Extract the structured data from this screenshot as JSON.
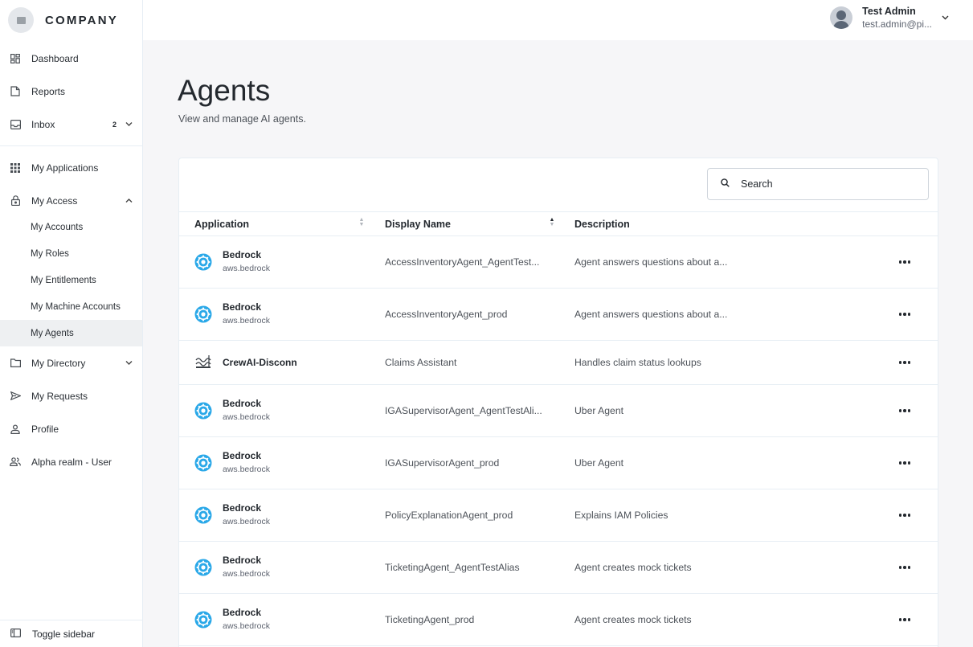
{
  "brand": {
    "name": "COMPANY"
  },
  "nav": {
    "dashboard": "Dashboard",
    "reports": "Reports",
    "inbox": "Inbox",
    "inbox_badge": "2",
    "my_applications": "My Applications",
    "my_access": "My Access",
    "my_access_sub": [
      "My Accounts",
      "My Roles",
      "My Entitlements",
      "My Machine Accounts",
      "My Agents"
    ],
    "my_directory": "My Directory",
    "my_requests": "My Requests",
    "profile": "Profile",
    "realm": "Alpha realm - User",
    "toggle": "Toggle sidebar"
  },
  "user": {
    "name": "Test Admin",
    "email": "test.admin@pi..."
  },
  "page": {
    "title": "Agents",
    "subtitle": "View and manage AI agents."
  },
  "search": {
    "placeholder": "Search"
  },
  "table": {
    "columns": {
      "application": "Application",
      "display_name": "Display Name",
      "description": "Description"
    },
    "rows": [
      {
        "app": "Bedrock",
        "app_sub": "aws.bedrock",
        "icon": "bedrock-icon",
        "display": "AccessInventoryAgent_AgentTest...",
        "desc": "Agent answers questions about a..."
      },
      {
        "app": "Bedrock",
        "app_sub": "aws.bedrock",
        "icon": "bedrock-icon",
        "display": "AccessInventoryAgent_prod",
        "desc": "Agent answers questions about a..."
      },
      {
        "app": "CrewAI-Disconn",
        "app_sub": "",
        "icon": "crewai-icon",
        "display": "Claims Assistant",
        "desc": "Handles claim status lookups"
      },
      {
        "app": "Bedrock",
        "app_sub": "aws.bedrock",
        "icon": "bedrock-icon",
        "display": "IGASupervisorAgent_AgentTestAli...",
        "desc": "Uber Agent"
      },
      {
        "app": "Bedrock",
        "app_sub": "aws.bedrock",
        "icon": "bedrock-icon",
        "display": "IGASupervisorAgent_prod",
        "desc": "Uber Agent"
      },
      {
        "app": "Bedrock",
        "app_sub": "aws.bedrock",
        "icon": "bedrock-icon",
        "display": "PolicyExplanationAgent_prod",
        "desc": "Explains IAM Policies"
      },
      {
        "app": "Bedrock",
        "app_sub": "aws.bedrock",
        "icon": "bedrock-icon",
        "display": "TicketingAgent_AgentTestAlias",
        "desc": "Agent creates mock tickets"
      },
      {
        "app": "Bedrock",
        "app_sub": "aws.bedrock",
        "icon": "bedrock-icon",
        "display": "TicketingAgent_prod",
        "desc": "Agent creates mock tickets"
      }
    ]
  },
  "colors": {
    "accent": "#23282e",
    "bedrock_blue": "#2aa8e8",
    "active_bg": "#eef0f2"
  }
}
